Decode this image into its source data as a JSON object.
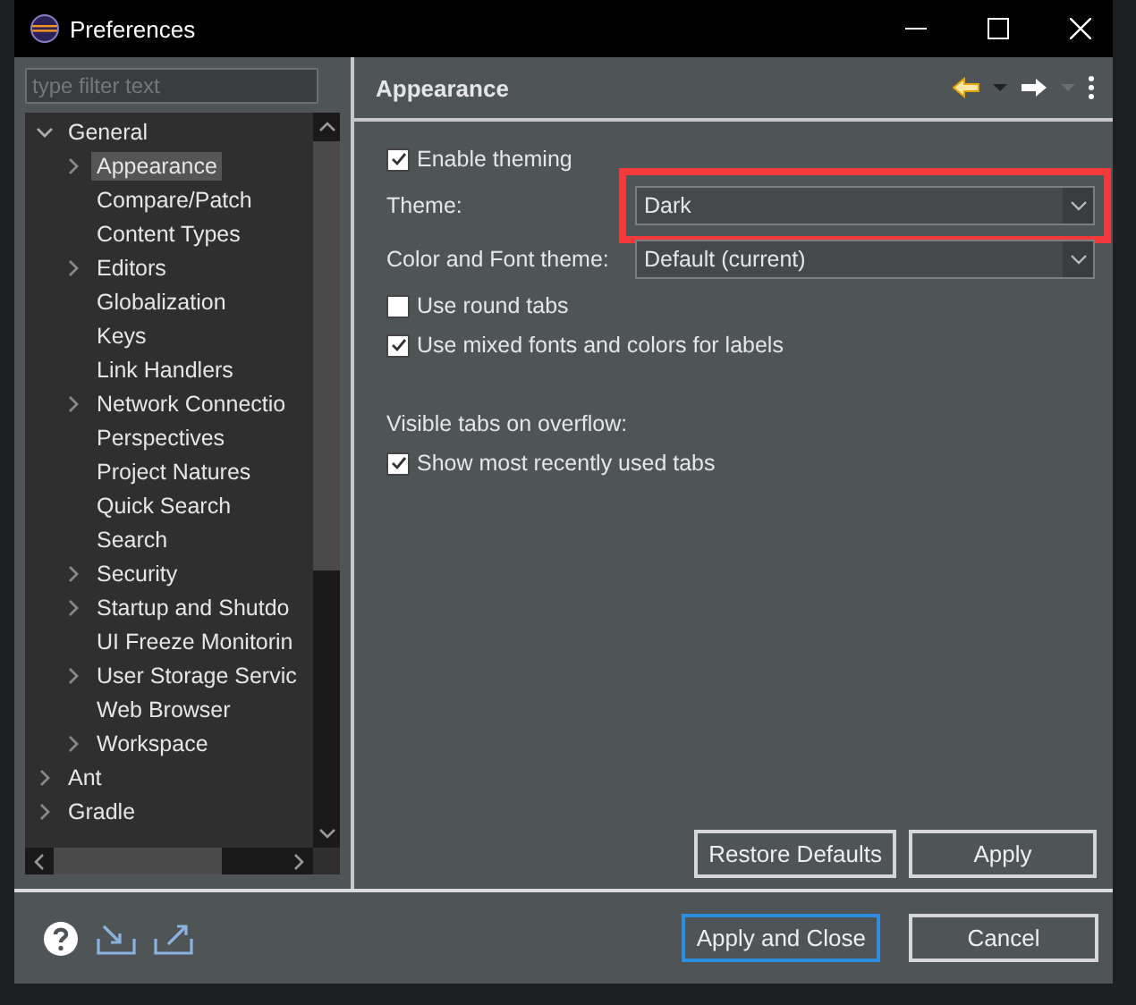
{
  "window": {
    "title": "Preferences"
  },
  "filter": {
    "placeholder": "type filter text"
  },
  "tree": [
    {
      "label": "General",
      "expandable": true,
      "expanded": true,
      "selected": false,
      "children": [
        {
          "label": "Appearance",
          "expandable": true,
          "expanded": false,
          "selected": true
        },
        {
          "label": "Compare/Patch",
          "expandable": false,
          "selected": false
        },
        {
          "label": "Content Types",
          "expandable": false,
          "selected": false
        },
        {
          "label": "Editors",
          "expandable": true,
          "expanded": false,
          "selected": false
        },
        {
          "label": "Globalization",
          "expandable": false,
          "selected": false
        },
        {
          "label": "Keys",
          "expandable": false,
          "selected": false
        },
        {
          "label": "Link Handlers",
          "expandable": false,
          "selected": false
        },
        {
          "label": "Network Connectio",
          "expandable": true,
          "expanded": false,
          "selected": false
        },
        {
          "label": "Perspectives",
          "expandable": false,
          "selected": false
        },
        {
          "label": "Project Natures",
          "expandable": false,
          "selected": false
        },
        {
          "label": "Quick Search",
          "expandable": false,
          "selected": false
        },
        {
          "label": "Search",
          "expandable": false,
          "selected": false
        },
        {
          "label": "Security",
          "expandable": true,
          "expanded": false,
          "selected": false
        },
        {
          "label": "Startup and Shutdo",
          "expandable": true,
          "expanded": false,
          "selected": false
        },
        {
          "label": "UI Freeze Monitorin",
          "expandable": false,
          "selected": false
        },
        {
          "label": "User Storage Servic",
          "expandable": true,
          "expanded": false,
          "selected": false
        },
        {
          "label": "Web Browser",
          "expandable": false,
          "selected": false
        },
        {
          "label": "Workspace",
          "expandable": true,
          "expanded": false,
          "selected": false
        }
      ]
    },
    {
      "label": "Ant",
      "expandable": true,
      "expanded": false,
      "selected": false
    },
    {
      "label": "Gradle",
      "expandable": true,
      "expanded": false,
      "selected": false
    }
  ],
  "page": {
    "title": "Appearance",
    "settings": [
      {
        "kind": "checkbox",
        "label": "Enable theming",
        "checked": true
      },
      {
        "kind": "combo",
        "label": "Theme:",
        "value": "Dark",
        "highlighted": true
      },
      {
        "kind": "combo",
        "label": "Color and Font theme:",
        "value": "Default (current)",
        "highlighted": false
      },
      {
        "kind": "checkbox",
        "label": "Use round tabs",
        "checked": false
      },
      {
        "kind": "checkbox",
        "label": "Use mixed fonts and colors for labels",
        "checked": true
      },
      {
        "kind": "heading",
        "label": "Visible tabs on overflow:"
      },
      {
        "kind": "checkbox",
        "label": "Show most recently used tabs",
        "checked": true
      }
    ],
    "buttons": [
      {
        "label": "Restore Defaults"
      },
      {
        "label": "Apply"
      }
    ]
  },
  "dialog_buttons": [
    {
      "label": "Apply and Close",
      "default": true
    },
    {
      "label": "Cancel",
      "default": false
    }
  ]
}
